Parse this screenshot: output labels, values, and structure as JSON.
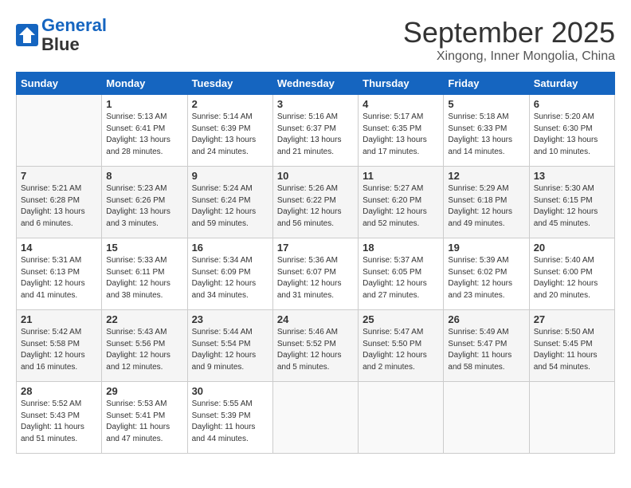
{
  "logo": {
    "line1": "General",
    "line2": "Blue"
  },
  "title": "September 2025",
  "subtitle": "Xingong, Inner Mongolia, China",
  "weekdays": [
    "Sunday",
    "Monday",
    "Tuesday",
    "Wednesday",
    "Thursday",
    "Friday",
    "Saturday"
  ],
  "weeks": [
    [
      {
        "day": "",
        "info": ""
      },
      {
        "day": "1",
        "info": "Sunrise: 5:13 AM\nSunset: 6:41 PM\nDaylight: 13 hours\nand 28 minutes."
      },
      {
        "day": "2",
        "info": "Sunrise: 5:14 AM\nSunset: 6:39 PM\nDaylight: 13 hours\nand 24 minutes."
      },
      {
        "day": "3",
        "info": "Sunrise: 5:16 AM\nSunset: 6:37 PM\nDaylight: 13 hours\nand 21 minutes."
      },
      {
        "day": "4",
        "info": "Sunrise: 5:17 AM\nSunset: 6:35 PM\nDaylight: 13 hours\nand 17 minutes."
      },
      {
        "day": "5",
        "info": "Sunrise: 5:18 AM\nSunset: 6:33 PM\nDaylight: 13 hours\nand 14 minutes."
      },
      {
        "day": "6",
        "info": "Sunrise: 5:20 AM\nSunset: 6:30 PM\nDaylight: 13 hours\nand 10 minutes."
      }
    ],
    [
      {
        "day": "7",
        "info": "Sunrise: 5:21 AM\nSunset: 6:28 PM\nDaylight: 13 hours\nand 6 minutes."
      },
      {
        "day": "8",
        "info": "Sunrise: 5:23 AM\nSunset: 6:26 PM\nDaylight: 13 hours\nand 3 minutes."
      },
      {
        "day": "9",
        "info": "Sunrise: 5:24 AM\nSunset: 6:24 PM\nDaylight: 12 hours\nand 59 minutes."
      },
      {
        "day": "10",
        "info": "Sunrise: 5:26 AM\nSunset: 6:22 PM\nDaylight: 12 hours\nand 56 minutes."
      },
      {
        "day": "11",
        "info": "Sunrise: 5:27 AM\nSunset: 6:20 PM\nDaylight: 12 hours\nand 52 minutes."
      },
      {
        "day": "12",
        "info": "Sunrise: 5:29 AM\nSunset: 6:18 PM\nDaylight: 12 hours\nand 49 minutes."
      },
      {
        "day": "13",
        "info": "Sunrise: 5:30 AM\nSunset: 6:15 PM\nDaylight: 12 hours\nand 45 minutes."
      }
    ],
    [
      {
        "day": "14",
        "info": "Sunrise: 5:31 AM\nSunset: 6:13 PM\nDaylight: 12 hours\nand 41 minutes."
      },
      {
        "day": "15",
        "info": "Sunrise: 5:33 AM\nSunset: 6:11 PM\nDaylight: 12 hours\nand 38 minutes."
      },
      {
        "day": "16",
        "info": "Sunrise: 5:34 AM\nSunset: 6:09 PM\nDaylight: 12 hours\nand 34 minutes."
      },
      {
        "day": "17",
        "info": "Sunrise: 5:36 AM\nSunset: 6:07 PM\nDaylight: 12 hours\nand 31 minutes."
      },
      {
        "day": "18",
        "info": "Sunrise: 5:37 AM\nSunset: 6:05 PM\nDaylight: 12 hours\nand 27 minutes."
      },
      {
        "day": "19",
        "info": "Sunrise: 5:39 AM\nSunset: 6:02 PM\nDaylight: 12 hours\nand 23 minutes."
      },
      {
        "day": "20",
        "info": "Sunrise: 5:40 AM\nSunset: 6:00 PM\nDaylight: 12 hours\nand 20 minutes."
      }
    ],
    [
      {
        "day": "21",
        "info": "Sunrise: 5:42 AM\nSunset: 5:58 PM\nDaylight: 12 hours\nand 16 minutes."
      },
      {
        "day": "22",
        "info": "Sunrise: 5:43 AM\nSunset: 5:56 PM\nDaylight: 12 hours\nand 12 minutes."
      },
      {
        "day": "23",
        "info": "Sunrise: 5:44 AM\nSunset: 5:54 PM\nDaylight: 12 hours\nand 9 minutes."
      },
      {
        "day": "24",
        "info": "Sunrise: 5:46 AM\nSunset: 5:52 PM\nDaylight: 12 hours\nand 5 minutes."
      },
      {
        "day": "25",
        "info": "Sunrise: 5:47 AM\nSunset: 5:50 PM\nDaylight: 12 hours\nand 2 minutes."
      },
      {
        "day": "26",
        "info": "Sunrise: 5:49 AM\nSunset: 5:47 PM\nDaylight: 11 hours\nand 58 minutes."
      },
      {
        "day": "27",
        "info": "Sunrise: 5:50 AM\nSunset: 5:45 PM\nDaylight: 11 hours\nand 54 minutes."
      }
    ],
    [
      {
        "day": "28",
        "info": "Sunrise: 5:52 AM\nSunset: 5:43 PM\nDaylight: 11 hours\nand 51 minutes."
      },
      {
        "day": "29",
        "info": "Sunrise: 5:53 AM\nSunset: 5:41 PM\nDaylight: 11 hours\nand 47 minutes."
      },
      {
        "day": "30",
        "info": "Sunrise: 5:55 AM\nSunset: 5:39 PM\nDaylight: 11 hours\nand 44 minutes."
      },
      {
        "day": "",
        "info": ""
      },
      {
        "day": "",
        "info": ""
      },
      {
        "day": "",
        "info": ""
      },
      {
        "day": "",
        "info": ""
      }
    ]
  ]
}
